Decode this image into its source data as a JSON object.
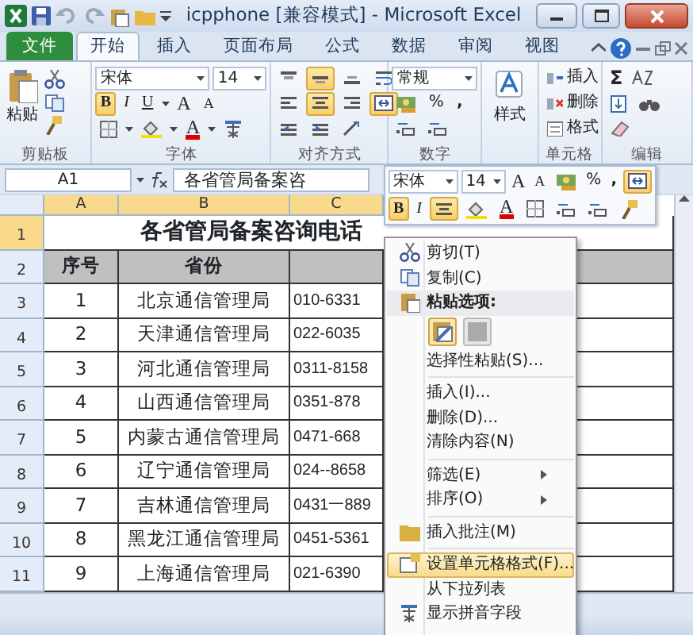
{
  "window": {
    "title": "icpphone [兼容模式] - Microsoft Excel"
  },
  "ribbon_tabs": [
    {
      "label": "文件",
      "kind": "file",
      "selected": false
    },
    {
      "label": "开始",
      "kind": "tab",
      "selected": true
    },
    {
      "label": "插入",
      "kind": "tab",
      "selected": false
    },
    {
      "label": "页面布局",
      "kind": "tab",
      "selected": false
    },
    {
      "label": "公式",
      "kind": "tab",
      "selected": false
    },
    {
      "label": "数据",
      "kind": "tab",
      "selected": false
    },
    {
      "label": "审阅",
      "kind": "tab",
      "selected": false
    },
    {
      "label": "视图",
      "kind": "tab",
      "selected": false
    }
  ],
  "ribbon": {
    "clipboard": {
      "label": "剪贴板",
      "paste": "粘贴"
    },
    "font": {
      "label": "字体",
      "font": "宋体",
      "size": "14",
      "buttons": [
        {
          "label": "B",
          "kind": "bold",
          "active": true
        },
        {
          "label": "I",
          "kind": "italic",
          "active": false
        },
        {
          "label": "U",
          "kind": "underline",
          "active": false
        }
      ],
      "grow": "A",
      "shrink": "A",
      "color_letter": "A"
    },
    "alignment": {
      "label": "对齐方式",
      "buttons": [
        {
          "kind": "top",
          "active": false
        },
        {
          "kind": "middle",
          "active": true
        },
        {
          "kind": "bottom",
          "active": false
        },
        {
          "kind": "wrap",
          "active": false
        },
        {
          "kind": "left",
          "active": false
        },
        {
          "kind": "center",
          "active": true
        },
        {
          "kind": "right",
          "active": false
        },
        {
          "kind": "merge",
          "active": true
        }
      ]
    },
    "number": {
      "label": "数字",
      "format": "常规",
      "percent": "%",
      "comma": ","
    },
    "styles": {
      "button": "样式"
    },
    "cells": {
      "label": "单元格",
      "items": [
        "插入",
        "删除",
        "格式"
      ]
    },
    "editing": {
      "label": "编辑",
      "sum": "Σ"
    }
  },
  "formula_bar": {
    "name_box": "A1",
    "content": "各省管局备案咨"
  },
  "sheet": {
    "columns": [
      {
        "label": "A",
        "selected": true
      },
      {
        "label": "B",
        "selected": true
      },
      {
        "label": "C",
        "selected": true
      }
    ],
    "rows": [
      {
        "number": "1",
        "kind": "title",
        "selected": true,
        "cells": [
          "",
          "各省管局备案咨询电话"
        ]
      },
      {
        "number": "2",
        "kind": "header",
        "selected": false,
        "cells": [
          "序号",
          "省份"
        ]
      },
      {
        "number": "3",
        "kind": "data",
        "selected": false,
        "cells": [
          "1",
          "北京通信管理局",
          "010-6331"
        ]
      },
      {
        "number": "4",
        "kind": "data",
        "selected": false,
        "cells": [
          "2",
          "天津通信管理局",
          "022-6035"
        ]
      },
      {
        "number": "5",
        "kind": "data",
        "selected": false,
        "cells": [
          "3",
          "河北通信管理局",
          "0311-8158"
        ]
      },
      {
        "number": "6",
        "kind": "data",
        "selected": false,
        "cells": [
          "4",
          "山西通信管理局",
          "0351-878"
        ]
      },
      {
        "number": "7",
        "kind": "data",
        "selected": false,
        "cells": [
          "5",
          "内蒙古通信管理局",
          "0471-668"
        ]
      },
      {
        "number": "8",
        "kind": "data",
        "selected": false,
        "cells": [
          "6",
          "辽宁通信管理局",
          "024--8658"
        ]
      },
      {
        "number": "9",
        "kind": "data",
        "selected": false,
        "cells": [
          "7",
          "吉林通信管理局",
          "0431一889"
        ]
      },
      {
        "number": "10",
        "kind": "data",
        "selected": false,
        "cells": [
          "8",
          "黑龙江通信管理局",
          "0451-5361"
        ]
      },
      {
        "number": "11",
        "kind": "data",
        "selected": false,
        "cells": [
          "9",
          "上海通信管理局",
          "021-6390"
        ]
      }
    ]
  },
  "mini_toolbar": {
    "font": "宋体",
    "size": "14",
    "grow": "A",
    "shrink": "A",
    "percent": "%",
    "comma": ",",
    "bold": "B",
    "bold_active": true,
    "italic": "I",
    "center_active": true,
    "merge_active": true,
    "color_letter": "A"
  },
  "context_menu": [
    {
      "kind": "cut",
      "label": "剪切(T)",
      "selected": false
    },
    {
      "kind": "copy",
      "label": "复制(C)",
      "selected": false
    },
    {
      "kind": "paste-header",
      "label": "粘贴选项:"
    },
    {
      "kind": "paste-buttons"
    },
    {
      "kind": "plain",
      "label": "选择性粘贴(S)...",
      "selected": false
    },
    {
      "kind": "separator"
    },
    {
      "kind": "plain",
      "label": "插入(I)...",
      "selected": false
    },
    {
      "kind": "plain",
      "label": "删除(D)...",
      "selected": false
    },
    {
      "kind": "plain",
      "label": "清除内容(N)",
      "selected": false
    },
    {
      "kind": "separator"
    },
    {
      "kind": "submenu",
      "label": "筛选(E)",
      "selected": false
    },
    {
      "kind": "submenu",
      "label": "排序(O)",
      "selected": false
    },
    {
      "kind": "separator"
    },
    {
      "kind": "comment",
      "label": "插入批注(M)",
      "selected": false
    },
    {
      "kind": "separator"
    },
    {
      "kind": "format",
      "label": "设置单元格格式(F)...",
      "selected": true
    },
    {
      "kind": "plain",
      "label": "从下拉列表",
      "selected": false
    },
    {
      "kind": "pinyin",
      "label": "显示拼音字段",
      "selected": false
    }
  ]
}
